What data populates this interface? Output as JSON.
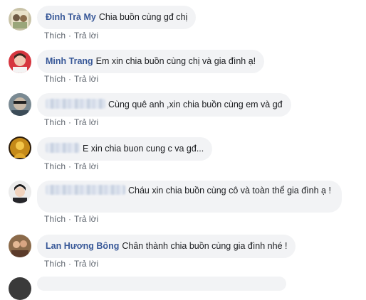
{
  "actions": {
    "like": "Thích",
    "separator": "·",
    "reply": "Trả lời"
  },
  "comments": [
    {
      "author": "Đinh Trà My",
      "text": "Chia buồn cùng gđ chị"
    },
    {
      "author": "Minh Trang",
      "text": "Em xin chia buồn cùng chị và gia đình ạ!"
    },
    {
      "author": "",
      "text": "Cùng quê anh ,xin chia buồn cùng em và gđ"
    },
    {
      "author": "",
      "text": "E xin chia buon cung c va gđ..."
    },
    {
      "author": "",
      "text": "Cháu xin chia buồn cùng cô và toàn thể gia đình ạ !"
    },
    {
      "author": "Lan Hương Bông",
      "text": "Chân thành chia buồn cùng gia đình nhé !"
    }
  ]
}
